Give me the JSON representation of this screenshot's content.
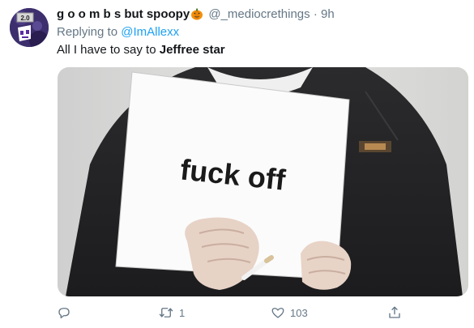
{
  "tweet": {
    "display_name": "g o o m b s but spoopy",
    "display_emoji_icon": "jack-o-lantern-icon",
    "handle": "@_mediocrethings",
    "separator": "·",
    "time": "9h",
    "replying_prefix": "Replying to",
    "replying_to": "@ImAllexx",
    "text_prefix": "All I have to say to",
    "text_bold": "Jeffree star",
    "media": {
      "sign_text": "fuck off"
    },
    "actions": {
      "reply_icon": "reply-icon",
      "retweet_icon": "retweet-icon",
      "retweet_count": "1",
      "like_icon": "heart-icon",
      "like_count": "103",
      "share_icon": "share-icon"
    }
  },
  "colors": {
    "text": "#14171a",
    "secondary": "#657786",
    "link": "#1da1f2"
  }
}
